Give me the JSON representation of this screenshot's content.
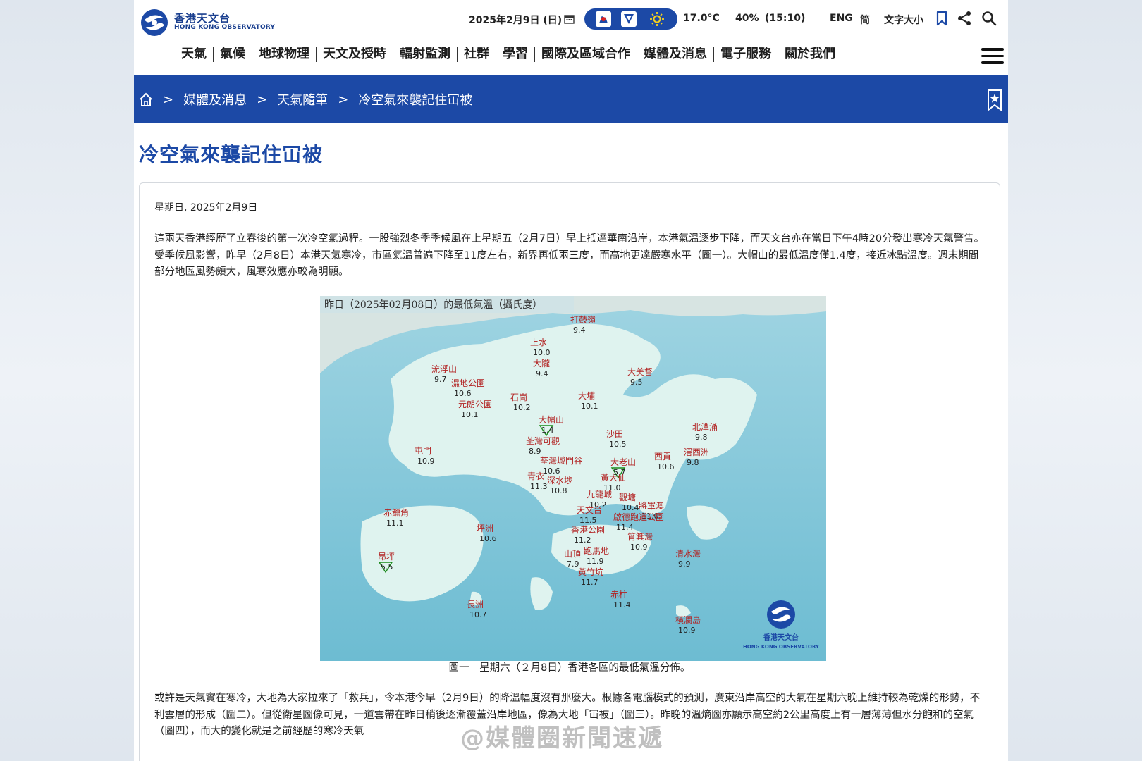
{
  "header": {
    "logo_zh": "香港天文台",
    "logo_en": "HONG KONG OBSERVATORY",
    "date": "2025年2月9日 (日)",
    "temperature": "17.0°C",
    "humidity": "40%",
    "time": "(15:10)",
    "lang_eng": "ENG",
    "lang_simplified": "简",
    "font_size": "文字大小"
  },
  "nav": {
    "items": [
      "天氣",
      "氣候",
      "地球物理",
      "天文及授時",
      "輻射監測",
      "社群",
      "學習",
      "國際及區域合作",
      "媒體及消息",
      "電子服務",
      "關於我們"
    ]
  },
  "breadcrumb": {
    "items": [
      "媒體及消息",
      "天氣隨筆",
      "冷空氣來襲記住冚被"
    ],
    "separator": ">"
  },
  "article": {
    "title": "冷空氣來襲記住冚被",
    "date": "星期日, 2025年2月9日",
    "para1": "這兩天香港經歷了立春後的第一次冷空氣過程。一股強烈冬季季候風在上星期五（2月7日）早上抵達華南沿岸，本港氣溫逐步下降，而天文台亦在當日下午4時20分發出寒冷天氣警告。受季候風影響，昨早（2月8日）本港天氣寒冷，市區氣溫普遍下降至11度左右，新界再低兩三度，而高地更達嚴寒水平（圖一）。大帽山的最低溫度僅1.4度，接近冰點溫度。週末期間部分地區風勢頗大，風寒效應亦較為明顯。",
    "caption": "圖一　星期六（２月8日）香港各區的最低氣溫分佈。",
    "para2": "或許是天氣實在寒冷，大地為大家拉來了「救兵」，令本港今早（2月9日）的降溫幅度沒有那麼大。根據各電腦模式的預測，廣東沿岸高空的大氣在星期六晚上維持較為乾燥的形勢，不利雲層的形成（圖二）。但從衛星圖像可見，一道雲帶在昨日稍後逐漸覆蓋沿岸地區，像為大地「冚被」（圖三）。昨晚的溫熵圖亦顯示高空約2公里高度上有一層薄薄但水分飽和的空氣（圖四），而大的變化就是之前經歷的寒冷天氣"
  },
  "figure": {
    "title": "昨日（2025年02月08日）的最低氣溫（攝氏度）",
    "logo_zh": "香港天文台",
    "logo_en": "HONG KONG OBSERVATORY",
    "stations": [
      {
        "name": "打鼓嶺",
        "temp": "9.4"
      },
      {
        "name": "上水",
        "temp": "10.0"
      },
      {
        "name": "大隴",
        "temp": "9.4"
      },
      {
        "name": "流浮山",
        "temp": "9.7"
      },
      {
        "name": "濕地公園",
        "temp": "10.6"
      },
      {
        "name": "大美督",
        "temp": "9.5"
      },
      {
        "name": "元朗公園",
        "temp": "10.1"
      },
      {
        "name": "石崗",
        "temp": "10.2"
      },
      {
        "name": "大埔",
        "temp": "10.1"
      },
      {
        "name": "大帽山",
        "temp": "1.4"
      },
      {
        "name": "北潭涌",
        "temp": "9.8"
      },
      {
        "name": "沙田",
        "temp": "10.5"
      },
      {
        "name": "荃灣可觀",
        "temp": "8.9"
      },
      {
        "name": "屯門",
        "temp": "10.9"
      },
      {
        "name": "荃灣城門谷",
        "temp": "10.6"
      },
      {
        "name": "大老山",
        "temp": "5.7"
      },
      {
        "name": "西貢",
        "temp": "10.6"
      },
      {
        "name": "滘西洲",
        "temp": "9.8"
      },
      {
        "name": "青衣",
        "temp": "11.3"
      },
      {
        "name": "深水埗",
        "temp": "10.8"
      },
      {
        "name": "黃大仙",
        "temp": "11.0"
      },
      {
        "name": "九龍城",
        "temp": "10.2"
      },
      {
        "name": "觀塘",
        "temp": "10.4"
      },
      {
        "name": "將軍澳",
        "temp": "11.0"
      },
      {
        "name": "赤鱲角",
        "temp": "11.1"
      },
      {
        "name": "天文台",
        "temp": "11.5"
      },
      {
        "name": "啟德跑道公園",
        "temp": "11.4"
      },
      {
        "name": "坪洲",
        "temp": "10.6"
      },
      {
        "name": "香港公園",
        "temp": "11.2"
      },
      {
        "name": "筲箕灣",
        "temp": "10.9"
      },
      {
        "name": "昂坪",
        "temp": "5.5"
      },
      {
        "name": "山頂",
        "temp": "7.9"
      },
      {
        "name": "跑馬地",
        "temp": "11.9"
      },
      {
        "name": "清水灣",
        "temp": "9.9"
      },
      {
        "name": "黃竹坑",
        "temp": "11.7"
      },
      {
        "name": "赤柱",
        "temp": "11.4"
      },
      {
        "name": "長洲",
        "temp": "10.7"
      },
      {
        "name": "橫瀾島",
        "temp": "10.9"
      }
    ]
  },
  "watermark": "@媒體圈新聞速遞",
  "colors": {
    "brand_blue": "#1c49a6",
    "sea": "#7fc6d8",
    "land": "#dff3ef",
    "station_label": "#b22222"
  }
}
